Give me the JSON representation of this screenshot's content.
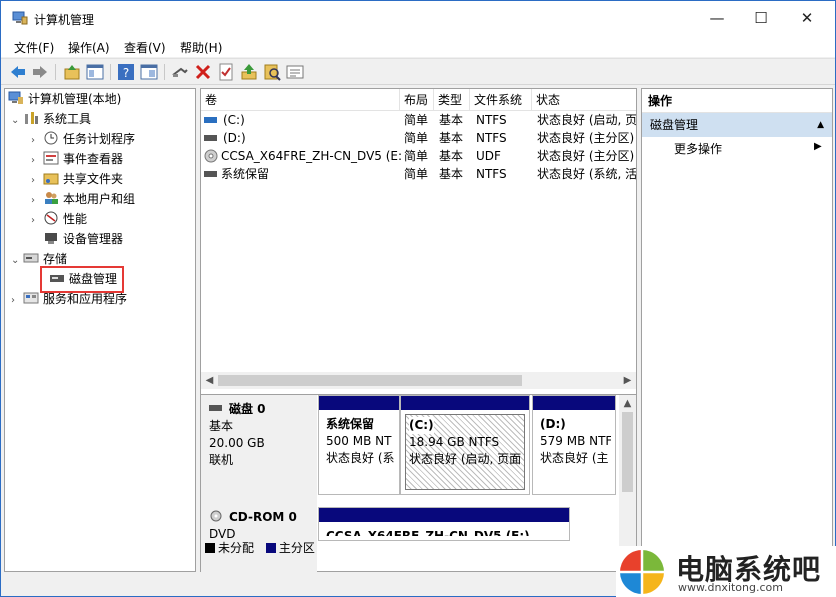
{
  "window": {
    "title": "计算机管理",
    "controls": {
      "minimize": "—",
      "maximize": "☐",
      "close": "✕"
    }
  },
  "menu": [
    {
      "label": "文件(F)"
    },
    {
      "label": "操作(A)"
    },
    {
      "label": "查看(V)"
    },
    {
      "label": "帮助(H)"
    }
  ],
  "toolbar": {
    "icons": [
      "back-arrow-icon",
      "forward-arrow-icon",
      "up-folder-icon",
      "show-hide-tree-icon",
      "help-icon",
      "properties-icon",
      "connect-icon",
      "delete-icon",
      "checklist-icon",
      "import-icon",
      "search-icon",
      "export-list-icon"
    ]
  },
  "tree": {
    "root": "计算机管理(本地)",
    "system_tools": "系统工具",
    "task_scheduler": "任务计划程序",
    "event_viewer": "事件查看器",
    "shared_folders": "共享文件夹",
    "local_users": "本地用户和组",
    "performance": "性能",
    "device_manager": "设备管理器",
    "storage": "存储",
    "disk_management": "磁盘管理",
    "services_apps": "服务和应用程序"
  },
  "volume_list": {
    "columns": [
      "卷",
      "布局",
      "类型",
      "文件系统",
      "状态"
    ],
    "rows": [
      {
        "volume": "(C:)",
        "layout": "简单",
        "type": "基本",
        "fs": "NTFS",
        "status": "状态良好 (启动, 页"
      },
      {
        "volume": "(D:)",
        "layout": "简单",
        "type": "基本",
        "fs": "NTFS",
        "status": "状态良好 (主分区)"
      },
      {
        "volume": "CCSA_X64FRE_ZH-CN_DV5 (E:)",
        "layout": "简单",
        "type": "基本",
        "fs": "UDF",
        "status": "状态良好 (主分区)"
      },
      {
        "volume": "系统保留",
        "layout": "简单",
        "type": "基本",
        "fs": "NTFS",
        "status": "状态良好 (系统, 活"
      }
    ]
  },
  "disks": {
    "disk0": {
      "name": "磁盘 0",
      "kind": "基本",
      "size": "20.00 GB",
      "state": "联机",
      "partitions": [
        {
          "name": "系统保留",
          "size": "500 MB NT",
          "status": "状态良好 (系"
        },
        {
          "name": "(C:)",
          "size": "18.94 GB NTFS",
          "status": "状态良好 (启动, 页面"
        },
        {
          "name": "(D:)",
          "size": "579 MB NTF",
          "status": "状态良好 (主"
        }
      ]
    },
    "cdrom0": {
      "name": "CD-ROM 0",
      "kind": "DVD",
      "partition_name": "CCSA_X64FRE_ZH-CN_DV5 (E:)"
    }
  },
  "legend": {
    "unallocated": "未分配",
    "primary": "主分区"
  },
  "actions": {
    "header": "操作",
    "section": "磁盘管理",
    "more": "更多操作"
  },
  "watermark": {
    "title": "电脑系统吧",
    "url": "www.dnxitong.com"
  },
  "colors": {
    "partition_bar": "#08087c",
    "selection_highlight": "#e53935",
    "actions_section_bg": "#cfe0f1"
  }
}
